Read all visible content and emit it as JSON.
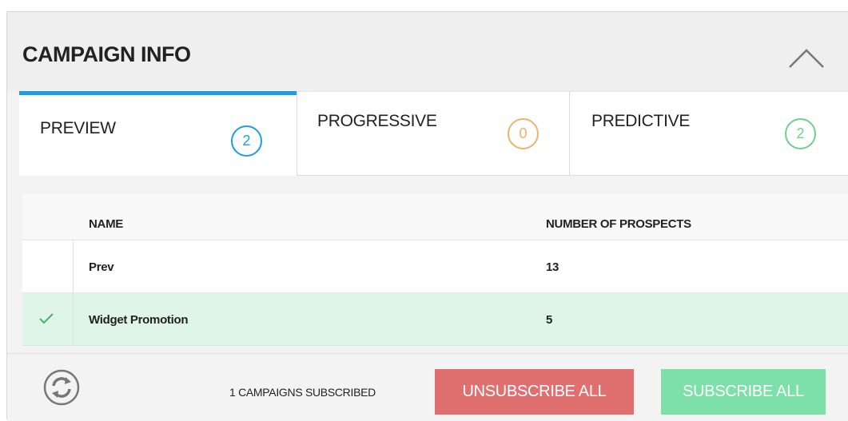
{
  "panel": {
    "title": "CAMPAIGN INFO",
    "collapse_icon": "chevron-up-icon"
  },
  "tabs": [
    {
      "label": "PREVIEW",
      "count": "2",
      "color": "#1aa0e0",
      "active": true
    },
    {
      "label": "PROGRESSIVE",
      "count": "0",
      "color": "#f0b06e",
      "active": false
    },
    {
      "label": "PREDICTIVE",
      "count": "2",
      "color": "#6fcf8c",
      "active": false
    }
  ],
  "table": {
    "headers": {
      "name": "NAME",
      "prospects": "NUMBER OF PROSPECTS"
    },
    "rows": [
      {
        "name": "Prev",
        "prospects": "13",
        "selected": false
      },
      {
        "name": "Widget Promotion",
        "prospects": "5",
        "selected": true
      }
    ]
  },
  "footer": {
    "refresh_icon": "refresh-icon",
    "status": "1 CAMPAIGNS SUBSCRIBED",
    "unsubscribe_label": "UNSUBSCRIBE ALL",
    "subscribe_label": "SUBSCRIBE ALL"
  },
  "colors": {
    "accent": "#1aa0e0",
    "danger": "#e07070",
    "success": "#7de0a8",
    "selected_row": "#dff5e8"
  }
}
